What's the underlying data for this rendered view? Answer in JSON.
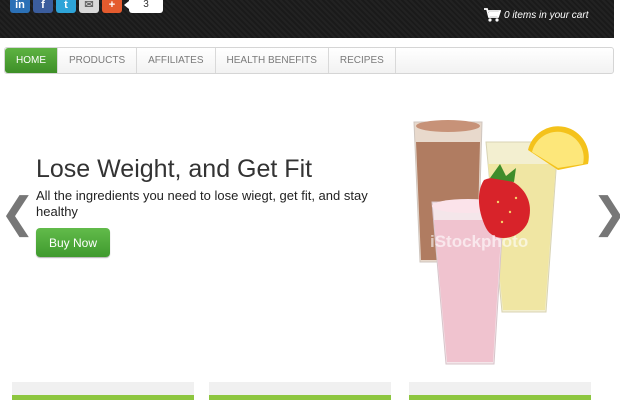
{
  "social": {
    "buttons": [
      {
        "icon": "linkedin-icon",
        "glyph": "in"
      },
      {
        "icon": "facebook-icon",
        "glyph": "f"
      },
      {
        "icon": "twitter-icon",
        "glyph": "t"
      },
      {
        "icon": "email-icon",
        "glyph": "✉"
      },
      {
        "icon": "google-plus-icon",
        "glyph": "+"
      }
    ],
    "share_count": "3"
  },
  "cart": {
    "icon": "cart-icon",
    "text": "0 items in your cart"
  },
  "nav": {
    "items": [
      {
        "label": "HOME",
        "active": true
      },
      {
        "label": "PRODUCTS",
        "active": false
      },
      {
        "label": "AFFILIATES",
        "active": false
      },
      {
        "label": "HEALTH BENEFITS",
        "active": false
      },
      {
        "label": "RECIPES",
        "active": false
      }
    ]
  },
  "hero": {
    "prev_glyph": "❮",
    "next_glyph": "❯",
    "title": "Lose Weight, and Get Fit",
    "subtitle": "All the ingredients you need to lose wiegt, get fit, and stay healthy",
    "cta": "Buy Now",
    "watermark": "iStockphoto"
  },
  "colors": {
    "accent_green": "#4aa834",
    "topbar": "#1e1e1e"
  }
}
